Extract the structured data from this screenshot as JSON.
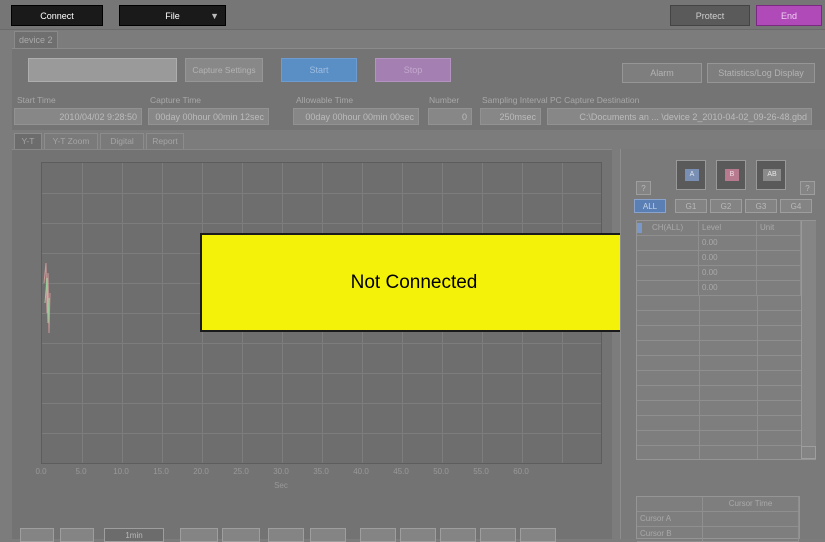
{
  "toolbar": {
    "connect_label": "Connect",
    "file_label": "File",
    "protect_label": "Protect",
    "end_label": "End"
  },
  "device_tab": "device 2",
  "controls": {
    "capture_settings": "Capture Settings",
    "start": "Start",
    "stop": "Stop",
    "alarm": "Alarm",
    "stats_log": "Statistics/Log Display"
  },
  "info": {
    "start_time_label": "Start Time",
    "start_time": "2010/04/02 9:28:50",
    "capture_time_label": "Capture Time",
    "capture_time": "00day 00hour 00min 12sec",
    "allowable_time_label": "Allowable Time",
    "allowable_time": "00day 00hour 00min 00sec",
    "number_label": "Number",
    "number": "0",
    "sampling_label": "Sampling Interval",
    "sampling": "250msec",
    "pc_dest_label": "PC Capture Destination",
    "pc_dest": "C:\\Documents an ... \\device 2_2010-04-02_09-26-48.gbd"
  },
  "view_tabs": [
    "Y-T",
    "Y-T Zoom",
    "Digital",
    "Report"
  ],
  "plot": {
    "x_ticks": [
      "0.0",
      "5.0",
      "10.0",
      "15.0",
      "20.0",
      "25.0",
      "30.0",
      "35.0",
      "40.0",
      "45.0",
      "50.0",
      "55.0",
      "60.0"
    ],
    "x_unit": "Sec",
    "overlay_message": "Not Connected"
  },
  "right_panel": {
    "help_left": "?",
    "help_right": "?",
    "icons": [
      "A",
      "B",
      "AB"
    ],
    "groups": [
      "ALL",
      "G1",
      "G2",
      "G3",
      "G4"
    ],
    "table_headers": [
      "CH(ALL)",
      "Level",
      "Unit"
    ],
    "levels": [
      "0.00",
      "0.00",
      "0.00",
      "0.00"
    ],
    "cursor_header": "Cursor Time",
    "cursor_rows": [
      "Cursor A",
      "Cursor B"
    ]
  },
  "bottom": {
    "range_label": "1min"
  },
  "colors": {
    "end_button": "#b04ab8",
    "not_connected_bg": "#f5f20a",
    "start_button": "#5a8fc6",
    "stop_button": "#a47fb2"
  }
}
